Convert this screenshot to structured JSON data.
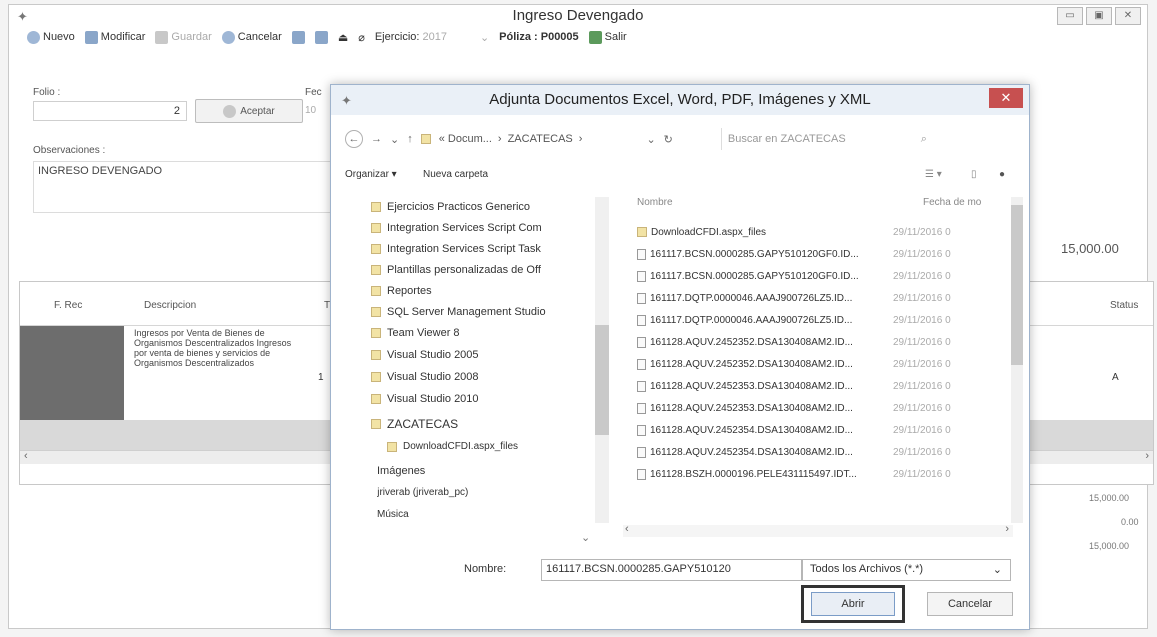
{
  "main": {
    "title": "Ingreso Devengado",
    "toolbar": {
      "nuevo": "Nuevo",
      "modificar": "Modificar",
      "guardar": "Guardar",
      "cancelar": "Cancelar",
      "ejercicio_label": "Ejercicio:",
      "ejercicio_value": "2017",
      "poliza": "Póliza : P00005",
      "salir": "Salir"
    },
    "folio_label": "Folio :",
    "folio_value": "2",
    "aceptar": "Aceptar",
    "fec_label": "Fec",
    "fec_value": "10",
    "observaciones_label": "Observaciones :",
    "observaciones_value": "INGRESO DEVENGADO",
    "total_top": "15,000.00",
    "grid": {
      "headers": {
        "f_rec": "F. Rec",
        "descripcion": "Descripcion",
        "t": "T",
        "status": "Status"
      },
      "row": {
        "descripcion": "Ingresos por Venta de Bienes de Organismos Descentralizados Ingresos por venta de bienes y servicios de Organismos Descentralizados",
        "t": "1",
        "status": "A"
      }
    },
    "summary": [
      "15,000.00",
      "0.00",
      "15,000.00"
    ]
  },
  "dialog": {
    "title": "Adjunta Documentos Excel, Word, PDF, Imágenes y XML",
    "path": [
      "« Docum...",
      "›",
      "ZACATECAS",
      "›"
    ],
    "search_placeholder": "Buscar en ZACATECAS",
    "organizar": "Organizar ▾",
    "nueva_carpeta": "Nueva carpeta",
    "tree": [
      "Ejercicios Practicos Generico",
      "Integration Services Script Com",
      "Integration Services Script Task",
      "Plantillas personalizadas de Off",
      "Reportes",
      "SQL Server Management Studio",
      "Team Viewer 8",
      "Visual Studio 2005",
      "Visual Studio 2008",
      "Visual Studio 2010",
      "ZACATECAS",
      "DownloadCFDI.aspx_files",
      "Imágenes",
      "jriverab (jriverab_pc)",
      "Música"
    ],
    "col_nombre": "Nombre",
    "col_fecha": "Fecha de mo",
    "files": [
      {
        "name": "DownloadCFDI.aspx_files",
        "date": "29/11/2016 0"
      },
      {
        "name": "161117.BCSN.0000285.GAPY510120GF0.ID...",
        "date": "29/11/2016 0"
      },
      {
        "name": "161117.BCSN.0000285.GAPY510120GF0.ID...",
        "date": "29/11/2016 0"
      },
      {
        "name": "161117.DQTP.0000046.AAAJ900726LZ5.ID...",
        "date": "29/11/2016 0"
      },
      {
        "name": "161117.DQTP.0000046.AAAJ900726LZ5.ID...",
        "date": "29/11/2016 0"
      },
      {
        "name": "161128.AQUV.2452352.DSA130408AM2.ID...",
        "date": "29/11/2016 0"
      },
      {
        "name": "161128.AQUV.2452352.DSA130408AM2.ID...",
        "date": "29/11/2016 0"
      },
      {
        "name": "161128.AQUV.2452353.DSA130408AM2.ID...",
        "date": "29/11/2016 0"
      },
      {
        "name": "161128.AQUV.2452353.DSA130408AM2.ID...",
        "date": "29/11/2016 0"
      },
      {
        "name": "161128.AQUV.2452354.DSA130408AM2.ID...",
        "date": "29/11/2016 0"
      },
      {
        "name": "161128.AQUV.2452354.DSA130408AM2.ID...",
        "date": "29/11/2016 0"
      },
      {
        "name": "161128.BSZH.0000196.PELE431115497.IDT...",
        "date": "29/11/2016 0"
      }
    ],
    "nombre_label": "Nombre:",
    "nombre_value": "161117.BCSN.0000285.GAPY510120",
    "filter": "Todos los Archivos (*.*)",
    "abrir": "Abrir",
    "cancelar": "Cancelar"
  }
}
